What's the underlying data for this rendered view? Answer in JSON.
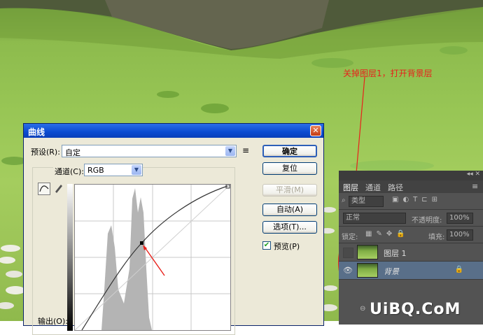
{
  "annotation": {
    "text": "关掉图层1，打开背景层",
    "color": "#e8211b"
  },
  "dialog": {
    "title": "曲线",
    "close": "✕",
    "preset_label": "预设(R):",
    "preset_value": "自定",
    "channel_label": "通道(C):",
    "channel_value": "RGB",
    "output_label": "输出(O):",
    "buttons": {
      "ok": "确定",
      "reset": "复位",
      "smooth": "平滑(M)",
      "auto": "自动(A)",
      "options": "选项(T)..."
    },
    "preview_label": "预览(P)",
    "preview_checked": true
  },
  "layers_panel": {
    "tabs": [
      "图层",
      "通道",
      "路径"
    ],
    "kind_label": "类型",
    "blend_mode": "正常",
    "opacity_label": "不透明度:",
    "opacity_value": "100%",
    "lock_label": "锁定:",
    "fill_label": "填充:",
    "fill_value": "100%",
    "layers": [
      {
        "name": "图层 1",
        "visible": false
      },
      {
        "name": "背景",
        "visible": true
      }
    ]
  },
  "watermark": "UiBQ.CoM"
}
